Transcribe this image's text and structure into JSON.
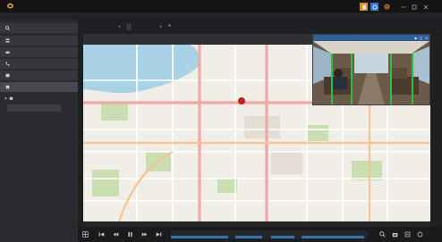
{
  "app": {
    "title": "",
    "user": "",
    "accent_color": "#f0a030",
    "active_button_color": "#e88a1a",
    "highlight_button_color": "#2f78d8"
  },
  "titlebar_buttons": [
    {
      "name": "notification-icon"
    },
    {
      "name": "help-icon"
    },
    {
      "name": "settings-icon"
    },
    {
      "name": "minimize-icon"
    },
    {
      "name": "maximize-icon"
    },
    {
      "name": "close-icon"
    }
  ],
  "menu": [
    "",
    "",
    "",
    "",
    ""
  ],
  "sidebar": {
    "search_label": "",
    "items": [
      {
        "label": "",
        "icon": "server-icon"
      },
      {
        "label": "",
        "icon": "camera-icon"
      },
      {
        "label": "",
        "icon": "tree-icon"
      },
      {
        "label": "",
        "icon": "map-icon"
      },
      {
        "label": "",
        "icon": "transportation-icon"
      }
    ],
    "tree_node": {
      "label": "",
      "icon": "bus-icon"
    },
    "tree_child": {
      "label": ""
    }
  },
  "workspace_tabs": [
    {
      "label": "",
      "selected": false
    },
    {
      "label": "",
      "selected": true
    }
  ],
  "map": {
    "header": "",
    "footer_left": "",
    "footer_center": "",
    "marker_color": "#d11a1a"
  },
  "video_popup": {
    "title": ""
  },
  "playback": {
    "buttons": [
      "grid-icon",
      "skip-back-icon",
      "step-back-icon",
      "pause-icon",
      "step-forward-icon",
      "skip-forward-icon"
    ],
    "right_buttons": [
      "zoom-icon",
      "snapshot-icon",
      "export-icon",
      "fullscreen-icon"
    ],
    "timeline_labels": [
      "",
      "",
      "",
      "",
      "",
      ""
    ]
  }
}
